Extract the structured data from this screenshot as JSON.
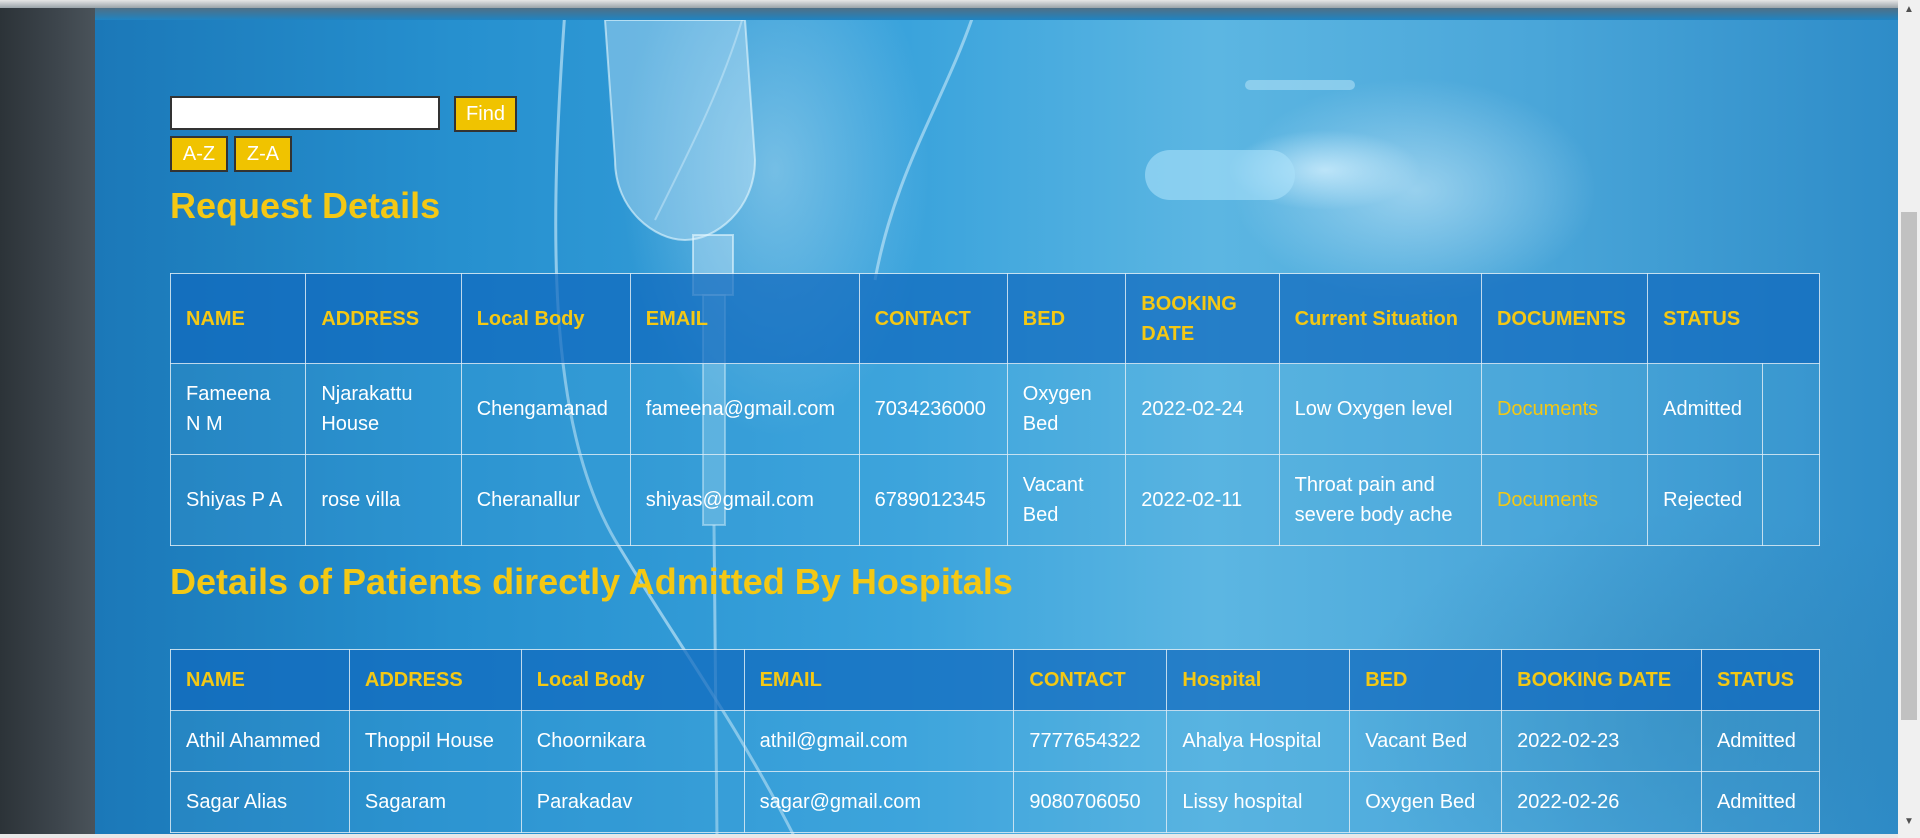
{
  "search": {
    "value": "",
    "find_label": "Find",
    "sort_az_label": "A-Z",
    "sort_za_label": "Z-A"
  },
  "requests": {
    "title": "Request Details",
    "columns": [
      "NAME",
      "ADDRESS",
      "Local Body",
      "EMAIL",
      "CONTACT",
      "BED",
      "BOOKING DATE",
      "Current Situation",
      "DOCUMENTS",
      "STATUS"
    ],
    "rows": [
      {
        "name": "Fameena N M",
        "address": "Njarakattu House",
        "local_body": "Chengamanad",
        "email": "fameena@gmail.com",
        "contact": "7034236000",
        "bed": "Oxygen Bed",
        "booking_date": "2022-02-24",
        "situation": "Low Oxygen level",
        "documents": "Documents",
        "status": "Admitted"
      },
      {
        "name": "Shiyas P A",
        "address": "rose villa",
        "local_body": "Cheranallur",
        "email": "shiyas@gmail.com",
        "contact": "6789012345",
        "bed": "Vacant Bed",
        "booking_date": "2022-02-11",
        "situation": "Throat pain and severe body ache",
        "documents": "Documents",
        "status": "Rejected"
      }
    ]
  },
  "admitted": {
    "title": "Details of Patients directly Admitted By Hospitals",
    "columns": [
      "NAME",
      "ADDRESS",
      "Local Body",
      "EMAIL",
      "CONTACT",
      "Hospital",
      "BED",
      "BOOKING DATE",
      "STATUS"
    ],
    "rows": [
      {
        "name": "Athil Ahammed",
        "address": "Thoppil House",
        "local_body": "Choornikara",
        "email": "athil@gmail.com",
        "contact": "7777654322",
        "hospital": "Ahalya Hospital",
        "bed": "Vacant Bed",
        "booking_date": "2022-02-23",
        "status": "Admitted"
      },
      {
        "name": "Sagar Alias",
        "address": "Sagaram",
        "local_body": "Parakadav",
        "email": "sagar@gmail.com",
        "contact": "9080706050",
        "hospital": "Lissy hospital",
        "bed": "Oxygen Bed",
        "booking_date": "2022-02-26",
        "status": "Admitted"
      }
    ]
  },
  "colors": {
    "accent_yellow": "#f4c814",
    "button_yellow": "#f0c300",
    "header_blue": "#1069be"
  },
  "icons": {
    "scroll_up": "scroll-up-arrow-icon",
    "scroll_down": "scroll-down-arrow-icon"
  }
}
